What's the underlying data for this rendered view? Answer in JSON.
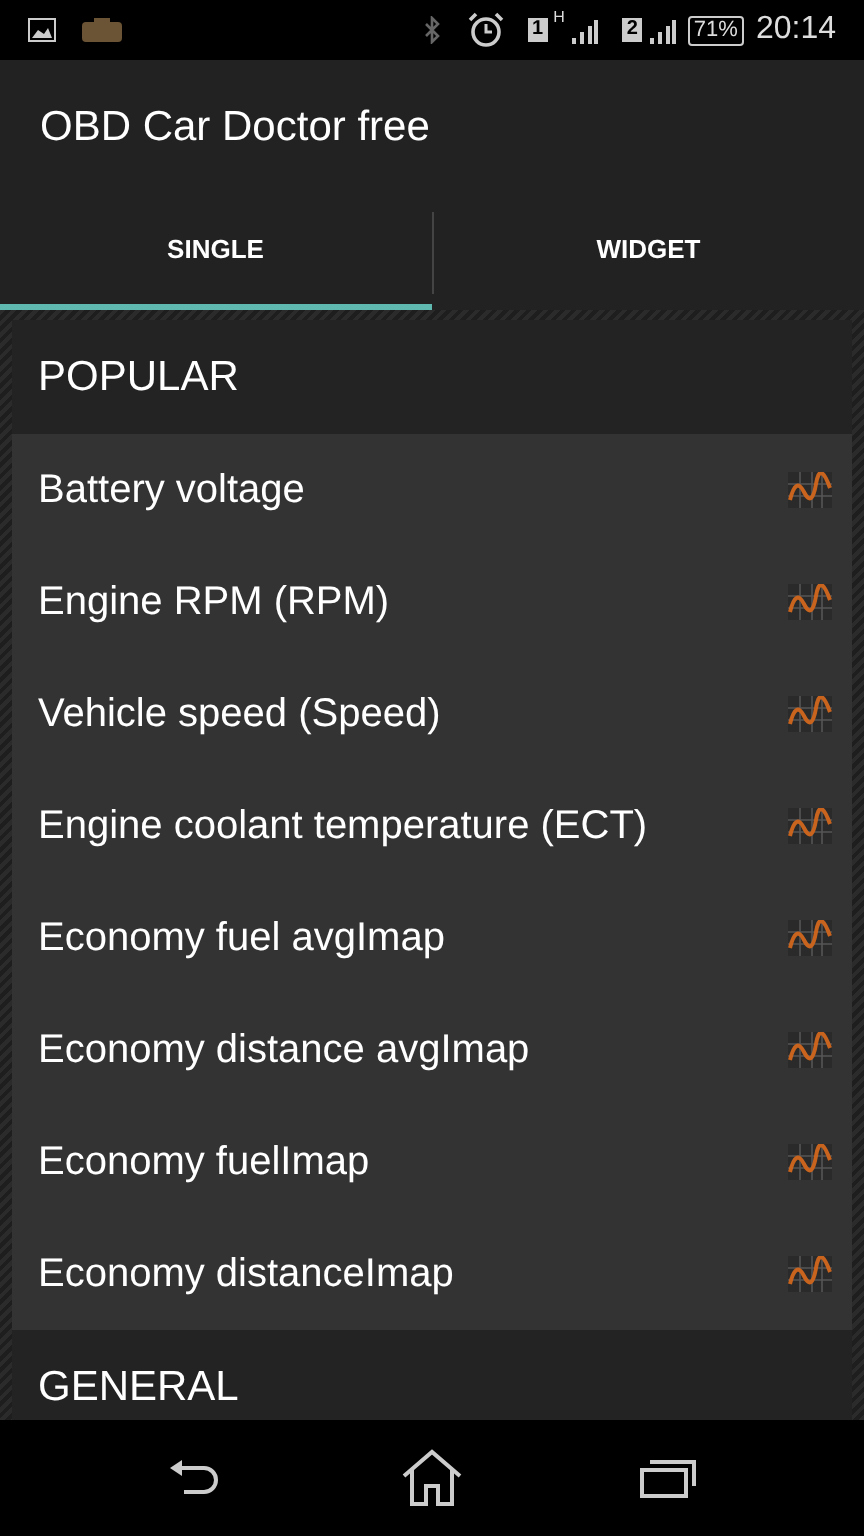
{
  "status_bar": {
    "sim_1": "1",
    "network_type": "H",
    "sim_2": "2",
    "battery": "71%",
    "time": "20:14"
  },
  "app_bar": {
    "title": "OBD Car Doctor free"
  },
  "tabs": [
    {
      "label": "SINGLE",
      "selected": true
    },
    {
      "label": "WIDGET",
      "selected": false
    }
  ],
  "sections": [
    {
      "title": "POPULAR",
      "items": [
        "Battery voltage",
        "Engine RPM (RPM)",
        "Vehicle speed (Speed)",
        "Engine coolant temperature (ECT)",
        "Economy fuel avgImap",
        "Economy distance avgImap",
        "Economy fuelImap",
        "Economy distanceImap"
      ]
    },
    {
      "title": "GENERAL"
    }
  ]
}
